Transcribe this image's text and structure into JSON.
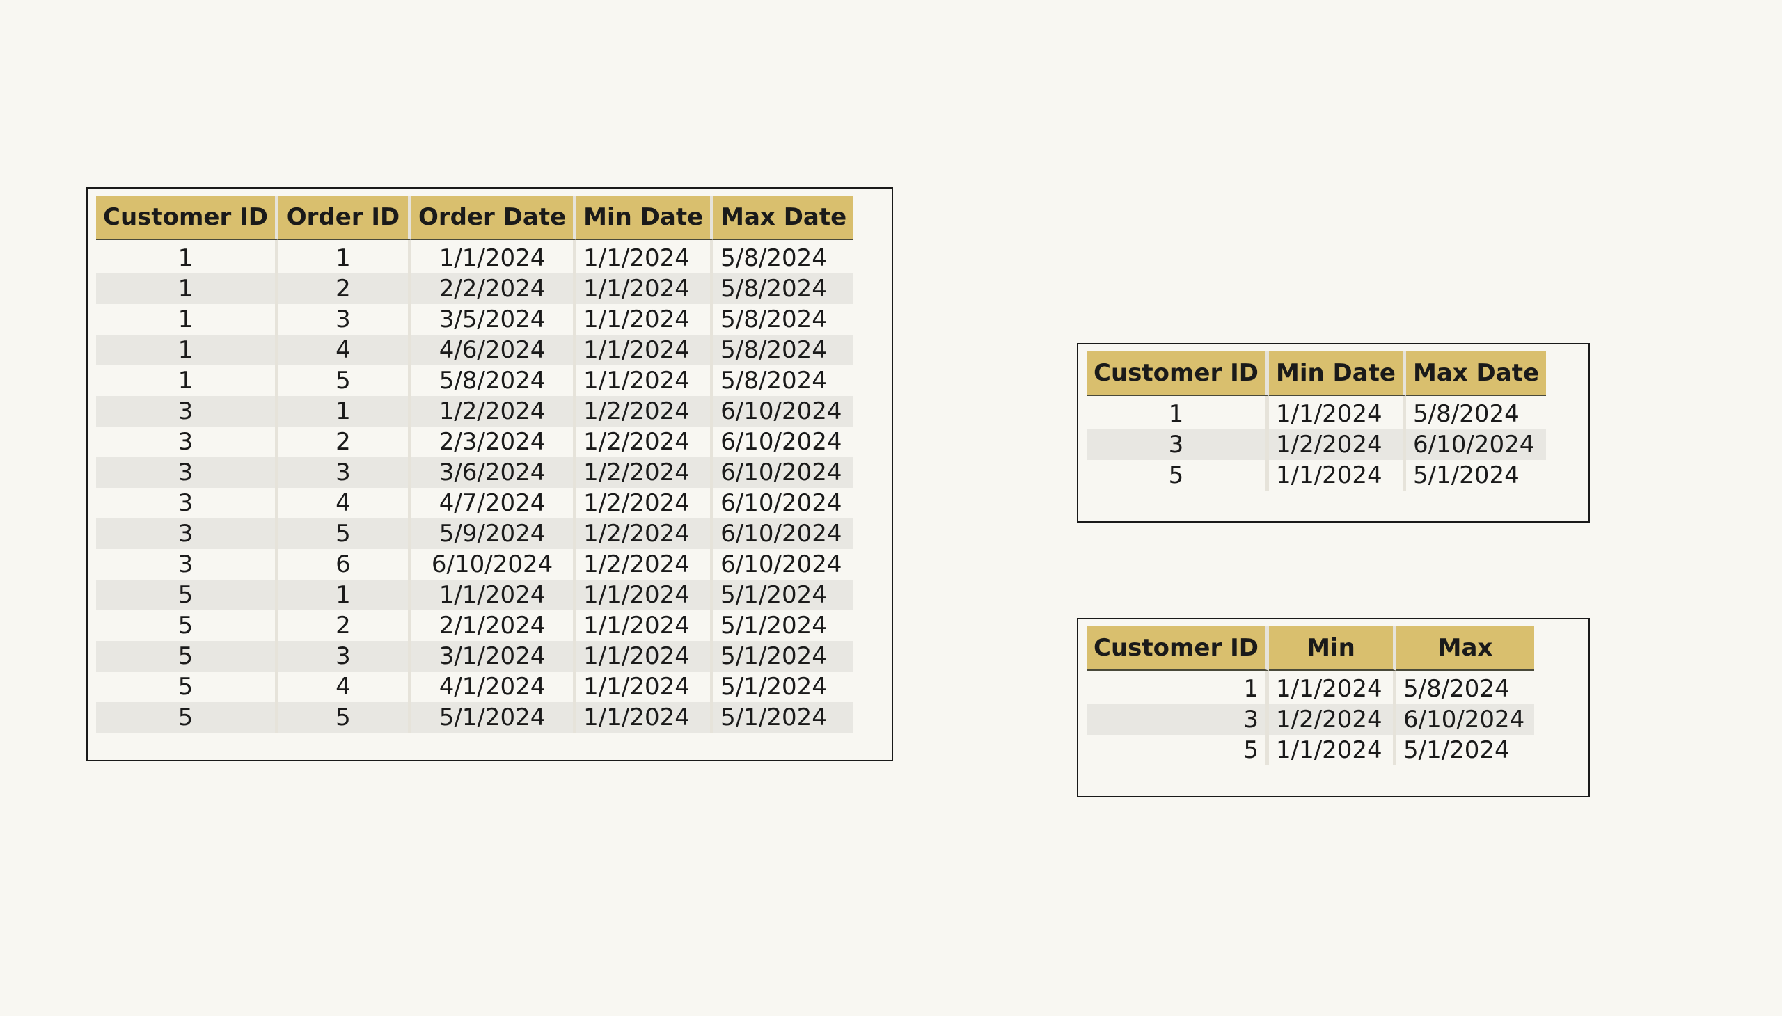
{
  "orders_table": {
    "headers": [
      "Customer ID",
      "Order ID",
      "Order Date",
      "Min Date",
      "Max Date"
    ],
    "rows": [
      [
        "1",
        "1",
        "1/1/2024",
        "1/1/2024",
        "5/8/2024"
      ],
      [
        "1",
        "2",
        "2/2/2024",
        "1/1/2024",
        "5/8/2024"
      ],
      [
        "1",
        "3",
        "3/5/2024",
        "1/1/2024",
        "5/8/2024"
      ],
      [
        "1",
        "4",
        "4/6/2024",
        "1/1/2024",
        "5/8/2024"
      ],
      [
        "1",
        "5",
        "5/8/2024",
        "1/1/2024",
        "5/8/2024"
      ],
      [
        "3",
        "1",
        "1/2/2024",
        "1/2/2024",
        "6/10/2024"
      ],
      [
        "3",
        "2",
        "2/3/2024",
        "1/2/2024",
        "6/10/2024"
      ],
      [
        "3",
        "3",
        "3/6/2024",
        "1/2/2024",
        "6/10/2024"
      ],
      [
        "3",
        "4",
        "4/7/2024",
        "1/2/2024",
        "6/10/2024"
      ],
      [
        "3",
        "5",
        "5/9/2024",
        "1/2/2024",
        "6/10/2024"
      ],
      [
        "3",
        "6",
        "6/10/2024",
        "1/2/2024",
        "6/10/2024"
      ],
      [
        "5",
        "1",
        "1/1/2024",
        "1/1/2024",
        "5/1/2024"
      ],
      [
        "5",
        "2",
        "2/1/2024",
        "1/1/2024",
        "5/1/2024"
      ],
      [
        "5",
        "3",
        "3/1/2024",
        "1/1/2024",
        "5/1/2024"
      ],
      [
        "5",
        "4",
        "4/1/2024",
        "1/1/2024",
        "5/1/2024"
      ],
      [
        "5",
        "5",
        "5/1/2024",
        "1/1/2024",
        "5/1/2024"
      ]
    ]
  },
  "summary_table": {
    "headers": [
      "Customer ID",
      "Min Date",
      "Max Date"
    ],
    "rows": [
      [
        "1",
        "1/1/2024",
        "5/8/2024"
      ],
      [
        "3",
        "1/2/2024",
        "6/10/2024"
      ],
      [
        "5",
        "1/1/2024",
        "5/1/2024"
      ]
    ]
  },
  "minmax_table": {
    "headers": [
      "Customer ID",
      "Min",
      "Max"
    ],
    "rows": [
      [
        "1",
        "1/1/2024",
        "5/8/2024"
      ],
      [
        "3",
        "1/2/2024",
        "6/10/2024"
      ],
      [
        "5",
        "1/1/2024",
        "5/1/2024"
      ]
    ]
  },
  "colors": {
    "header_bg": "#d9bf6e",
    "alt_row_bg": "#e8e7e2",
    "page_bg": "#f8f7f2"
  }
}
